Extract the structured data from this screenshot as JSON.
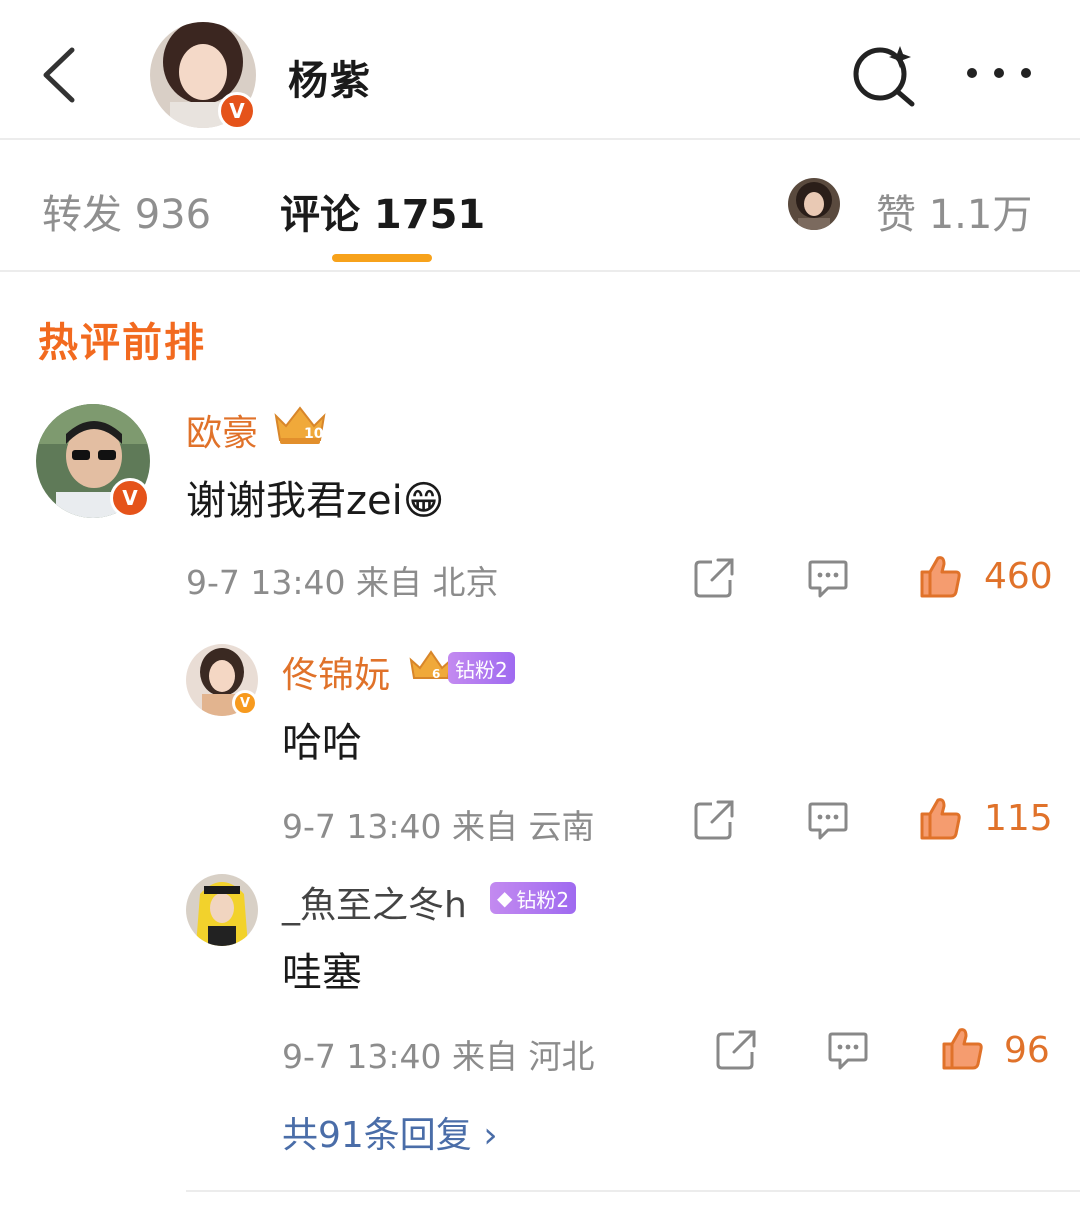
{
  "header": {
    "title": "杨紫",
    "icons": [
      "back-icon",
      "search-icon",
      "more-icon"
    ]
  },
  "tabs": {
    "repost": "转发 936",
    "comment": "评论 1751",
    "like": "赞 1.1万"
  },
  "section_title": "热评前排",
  "comments": [
    {
      "username": "欧豪",
      "content": "谢谢我君zei😁",
      "meta": "9-7 13:40 来自 北京",
      "likes": "460",
      "crown_level": "10"
    }
  ],
  "replies": [
    {
      "username": "佟锦妧",
      "badge": "钻粉2",
      "content": "哈哈",
      "meta": "9-7 13:40 来自 云南",
      "likes": "115",
      "crown_level": "6"
    },
    {
      "username": "_魚至之冬h",
      "badge": "钻粉2",
      "content": "哇塞",
      "meta": "9-7 13:40 来自 河北",
      "likes": "96"
    }
  ],
  "more_replies": "共91条回复 ›",
  "colors": {
    "accent_orange": "#e0722a",
    "section_orange": "#f26a1f",
    "tab_underline": "#f7a21b",
    "link_blue": "#4a6da8",
    "badge_purple": "#a872f0"
  }
}
